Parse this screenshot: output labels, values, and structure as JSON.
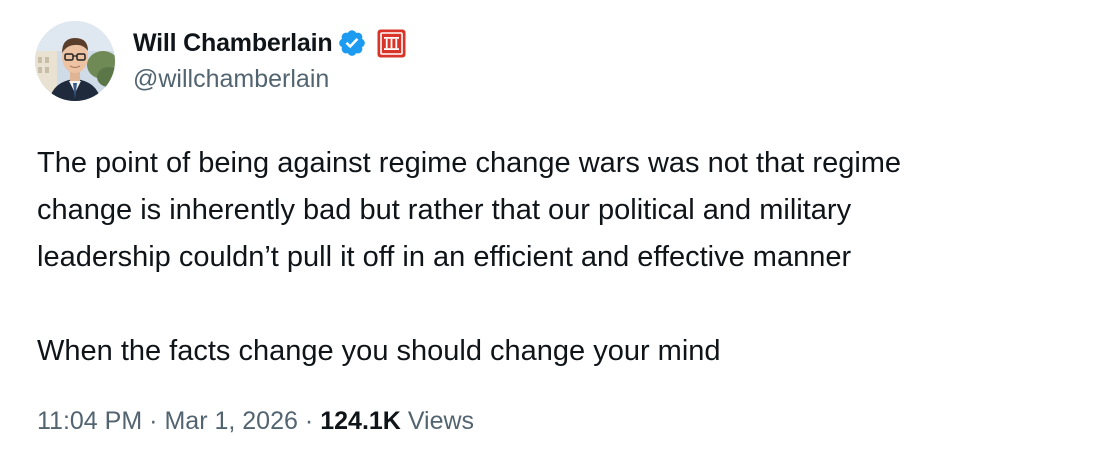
{
  "author": {
    "display_name": "Will Chamberlain",
    "handle": "@willchamberlain",
    "verified_icon": "verified-badge-icon",
    "affiliation_icon": "roman-numeral-badge-icon",
    "affiliation_text": "III"
  },
  "tweet": {
    "lines": [
      "The point of being against regime change wars was not that regime",
      "change is inherently bad but rather that our political and military",
      "leadership couldn’t pull it off in an efficient and effective manner"
    ],
    "second_paragraph": "When the facts change you should change your mind"
  },
  "meta": {
    "time": "11:04 PM",
    "date": "Mar 1, 2026",
    "separator": "·",
    "views_count": "124.1K",
    "views_label": "Views"
  },
  "colors": {
    "text_primary": "#0f1419",
    "text_secondary": "#536471",
    "verified_blue": "#1d9bf0",
    "badge_red": "#d8342a"
  }
}
